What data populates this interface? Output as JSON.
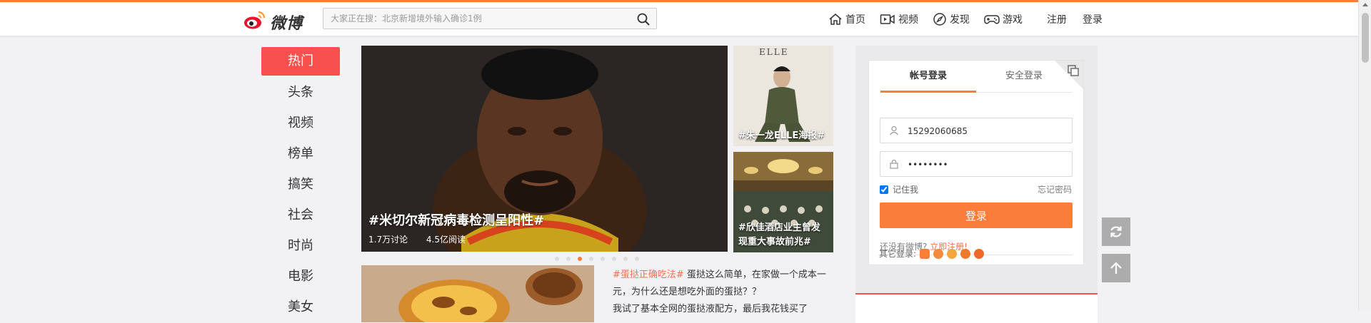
{
  "header": {
    "logo_text": "微博",
    "search": {
      "placeholder": "大家正在搜：北京新增境外输入确诊1例"
    },
    "nav": [
      {
        "label": "首页",
        "icon": "home-icon"
      },
      {
        "label": "视频",
        "icon": "video-icon"
      },
      {
        "label": "发现",
        "icon": "compass-icon"
      },
      {
        "label": "游戏",
        "icon": "gamepad-icon"
      }
    ],
    "register": "注册",
    "login": "登录"
  },
  "sidebar": {
    "items": [
      {
        "label": "热门",
        "active": true
      },
      {
        "label": "头条"
      },
      {
        "label": "视频"
      },
      {
        "label": "榜单"
      },
      {
        "label": "搞笑"
      },
      {
        "label": "社会"
      },
      {
        "label": "时尚"
      },
      {
        "label": "电影"
      },
      {
        "label": "美女"
      }
    ]
  },
  "carousel": {
    "main": {
      "caption": "#米切尔新冠病毒检测呈阳性#",
      "discussions": "1.7万讨论",
      "reads": "4.5亿阅读"
    },
    "side": [
      {
        "caption": "#朱一龙ELLE海报#",
        "magazine": "ELLE"
      },
      {
        "caption": "#欣佳酒店业主曾发现重大事故前兆#"
      }
    ],
    "dots": 8,
    "active_dot": 3
  },
  "feed": {
    "tag": "#蛋挞正确吃法#",
    "text1": " 蛋挞这么简单，在家做一个成本一元，为什么还是想吃外面的蛋挞？？",
    "text2": "我试了基本全网的蛋挞液配方，最后我花钱买了"
  },
  "login": {
    "tabs": [
      "帐号登录",
      "安全登录"
    ],
    "username": "15292060685",
    "password": "••••••••",
    "remember": "记住我",
    "forgot": "忘记密码",
    "submit": "登录",
    "no_account": "还没有微博?",
    "register_link": "立即注册!",
    "other_login": "其它登录:"
  },
  "colors": {
    "accent": "#fa7d3c",
    "hot_red": "#f7504e",
    "link_orange": "#eb7350"
  }
}
